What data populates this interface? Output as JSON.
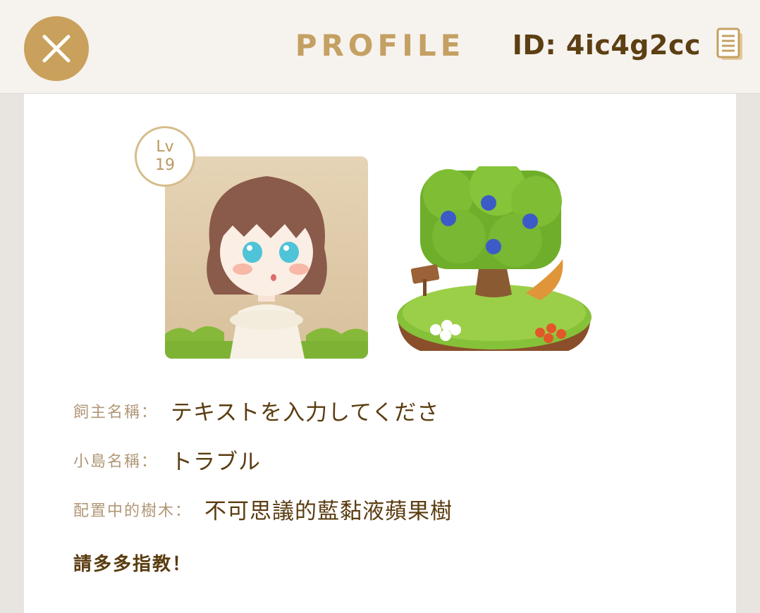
{
  "header": {
    "title": "PROFILE",
    "id_text": "ID: 4ic4g2cc",
    "close_icon": "close-icon",
    "copy_icon": "copy-icon"
  },
  "profile": {
    "level_label": "Lv",
    "level_value": "19",
    "fields": [
      {
        "label": "飼主名稱：",
        "value": "テキストを入力してくださ"
      },
      {
        "label": "小島名稱：",
        "value": "トラブル"
      },
      {
        "label": "配置中的樹木：",
        "value": "不可思議的藍黏液蘋果樹"
      }
    ],
    "bio": "請多多指教！"
  },
  "colors": {
    "accent_gold": "#c9a15c",
    "title_gold": "#c4a062",
    "text_brown": "#5a3c10",
    "label_tan": "#b09776"
  }
}
